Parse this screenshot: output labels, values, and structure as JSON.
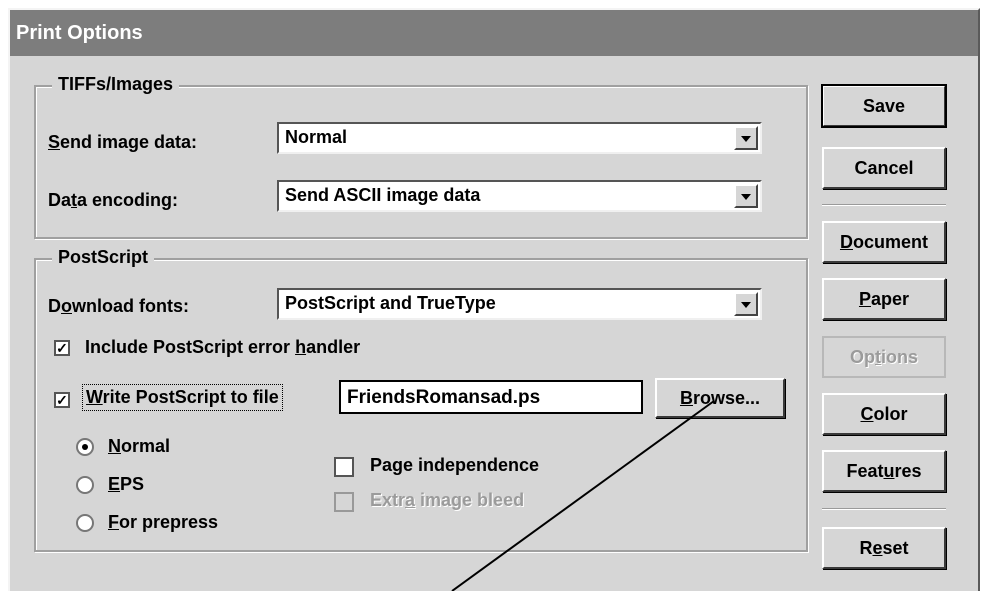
{
  "window": {
    "title": "Print Options"
  },
  "tiffs": {
    "legend": "TIFFs/Images",
    "send_label_pre": "",
    "send_label_ul": "S",
    "send_label_post": "end image data:",
    "send_value": "Normal",
    "enc_label_pre": "Da",
    "enc_label_ul": "t",
    "enc_label_post": "a encoding:",
    "enc_value": "Send ASCII image data"
  },
  "postscript": {
    "legend": "PostScript",
    "dl_label_pre": "D",
    "dl_label_ul": "o",
    "dl_label_post": "wnload fonts:",
    "dl_value": "PostScript and TrueType",
    "err_pre": "Include PostScript error ",
    "err_ul": "h",
    "err_post": "andler",
    "err_checked": true,
    "write_ul": "W",
    "write_post": "rite PostScript to file",
    "write_checked": true,
    "file_value": "FriendsRomansad.ps",
    "browse_ul": "B",
    "browse_post": "rowse...",
    "radios": [
      {
        "ul": "N",
        "post": "ormal",
        "checked": true
      },
      {
        "ul": "E",
        "post": "PS",
        "checked": false
      },
      {
        "ul": "F",
        "post": "or prepress",
        "checked": false
      }
    ],
    "page_ind_pre": "Pa",
    "page_ind_ul": "g",
    "page_ind_post": "e independence",
    "page_ind_checked": false,
    "bleed_pre": "Extr",
    "bleed_ul": "a",
    "bleed_post": " image bleed",
    "bleed_checked": false
  },
  "buttons": {
    "save": "Save",
    "cancel": "Cancel",
    "document_ul": "D",
    "document_post": "ocument",
    "paper_ul": "P",
    "paper_post": "aper",
    "options_pre": "Op",
    "options_ul": "t",
    "options_post": "ions",
    "color_ul": "C",
    "color_post": "olor",
    "features_pre": "Feat",
    "features_ul": "u",
    "features_post": "res",
    "reset_pre": "R",
    "reset_ul": "e",
    "reset_post": "set"
  },
  "colors": {
    "title_bar": "#7d7d7d",
    "dialog_bg": "#d6d6d6"
  },
  "icons": {
    "check": "checkmark-icon",
    "combo_arrow": "chevron-down-icon",
    "annotation": "pointer-line"
  }
}
